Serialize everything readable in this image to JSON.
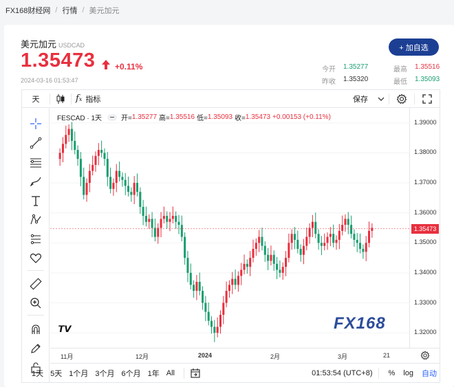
{
  "breadcrumb": {
    "home": "FX168财经网",
    "section": "行情",
    "current": "美元加元"
  },
  "quote": {
    "name": "美元加元",
    "code": "USDCAD",
    "price": "1.35473",
    "change": "+0.11%",
    "timestamp": "2024-03-16 01:53:47",
    "add_button": "+ 加自选",
    "stats": {
      "open_label": "今开",
      "open": "1.35277",
      "prev_label": "昨收",
      "prev": "1.35320",
      "high_label": "最高",
      "high": "1.35516",
      "low_label": "最低",
      "low": "1.35093"
    },
    "colors": {
      "up": "#e8303f",
      "down": "#1a9e6f",
      "brand": "#1c3f94"
    }
  },
  "toolbar": {
    "interval": "天",
    "indicators": "指标",
    "save": "保存"
  },
  "legend": {
    "symbol": "FESCAD · 1天",
    "open_label": "开=",
    "open": "1.35277",
    "high_label": "高=",
    "high": "1.35516",
    "low_label": "低=",
    "low": "1.35093",
    "close_label": "收=",
    "close": "1.35473",
    "change": "+0.00153 (+0.11%)"
  },
  "bottombar": {
    "ranges": [
      "1天",
      "5天",
      "1个月",
      "3个月",
      "6个月",
      "1年",
      "All"
    ],
    "clock": "01:53:54 (UTC+8)",
    "percent": "%",
    "log": "log",
    "auto": "自动"
  },
  "watermark": {
    "text": "FX168"
  },
  "chart_data": {
    "type": "candlestick",
    "interval": "1D",
    "ylim": [
      1.315,
      1.395
    ],
    "yticks": [
      "1.39000",
      "1.38000",
      "1.37000",
      "1.36000",
      "1.35000",
      "1.34000",
      "1.33000",
      "1.32000"
    ],
    "xticks": [
      "11月",
      "12月",
      "2024",
      "2月",
      "3月",
      "21"
    ],
    "last_price_label": "1.35473",
    "last_price": 1.35473,
    "candles_approx_close": [
      1.38,
      1.383,
      1.386,
      1.388,
      1.384,
      1.381,
      1.378,
      1.372,
      1.366,
      1.37,
      1.374,
      1.376,
      1.379,
      1.381,
      1.38,
      1.378,
      1.372,
      1.368,
      1.37,
      1.374,
      1.372,
      1.371,
      1.369,
      1.367,
      1.366,
      1.37,
      1.367,
      1.362,
      1.359,
      1.357,
      1.358,
      1.355,
      1.352,
      1.355,
      1.358,
      1.359,
      1.357,
      1.358,
      1.359,
      1.357,
      1.356,
      1.352,
      1.345,
      1.34,
      1.336,
      1.334,
      1.337,
      1.334,
      1.33,
      1.327,
      1.324,
      1.322,
      1.32,
      1.322,
      1.326,
      1.33,
      1.334,
      1.336,
      1.338,
      1.336,
      1.339,
      1.341,
      1.343,
      1.342,
      1.345,
      1.348,
      1.35,
      1.352,
      1.349,
      1.346,
      1.344,
      1.346,
      1.343,
      1.341,
      1.34,
      1.342,
      1.345,
      1.35,
      1.353,
      1.351,
      1.348,
      1.346,
      1.349,
      1.352,
      1.355,
      1.357,
      1.353,
      1.35,
      1.349,
      1.35,
      1.352,
      1.353,
      1.35,
      1.351,
      1.354,
      1.356,
      1.358,
      1.356,
      1.353,
      1.351,
      1.35,
      1.348,
      1.347,
      1.35,
      1.354,
      1.355
    ]
  }
}
